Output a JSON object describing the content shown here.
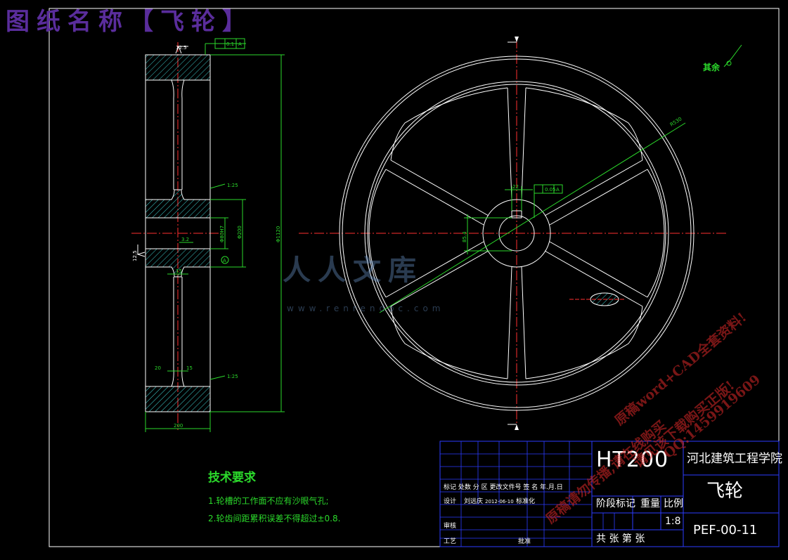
{
  "banner": {
    "title": "图纸名称【飞轮】"
  },
  "roughness": {
    "other": "其余"
  },
  "tech_requirements": {
    "title": "技术要求",
    "items": [
      "1.轮槽的工作面不应有沙眼气孔;",
      "2.轮齿间距累积误差不得超过±0.8."
    ]
  },
  "dimensions": {
    "ra_top": "12.5",
    "ra_left": "12.5",
    "tol_a": "0.1",
    "datum": "A",
    "taper_1": "1:25",
    "taper_2": "1:25",
    "bore": "Φ80H7",
    "outer_dia": "Φ1120",
    "hub_dia": "Φ200",
    "width": "200",
    "r_side": "3.2",
    "web": "15",
    "rim_a": "20",
    "rim_b": "15",
    "key_width": "22",
    "key_height": "85.4",
    "radius": "R530",
    "sym_tol": "0.05"
  },
  "title_block": {
    "material": "HT200",
    "school": "河北建筑工程学院",
    "part_name": "飞轮",
    "drawing_no": "PEF-00-11",
    "scale": "1:8",
    "row_labels": "标记 处数 分 区 更改文件号 签 名 年.月.日",
    "design_label": "设计",
    "designer": "刘远庆",
    "design_date": "2012-06-10",
    "standard_label": "标准化",
    "review_label": "审核",
    "process_label": "工艺",
    "approve_label": "批准",
    "stage_label": "阶段标记",
    "weight_label": "重量",
    "scale_label": "比例",
    "sheets_label": "共  张 第  张"
  },
  "watermark": {
    "logo": "人人文库",
    "url": "www.renrendoc.com",
    "lines": [
      "原稿word+CAD全套资料!",
      "QQ:1459919609",
      "请见该下载购买正版!",
      "原稿请勿传播,请在线购买"
    ]
  },
  "colors": {
    "background": "#000000",
    "outline": "#ffffff",
    "dimension": "#2bd92b",
    "centerline": "#ff3030",
    "hatch": "#3fd0d0",
    "titleblock": "#2b3cff",
    "banner": "#5a2d9c"
  }
}
